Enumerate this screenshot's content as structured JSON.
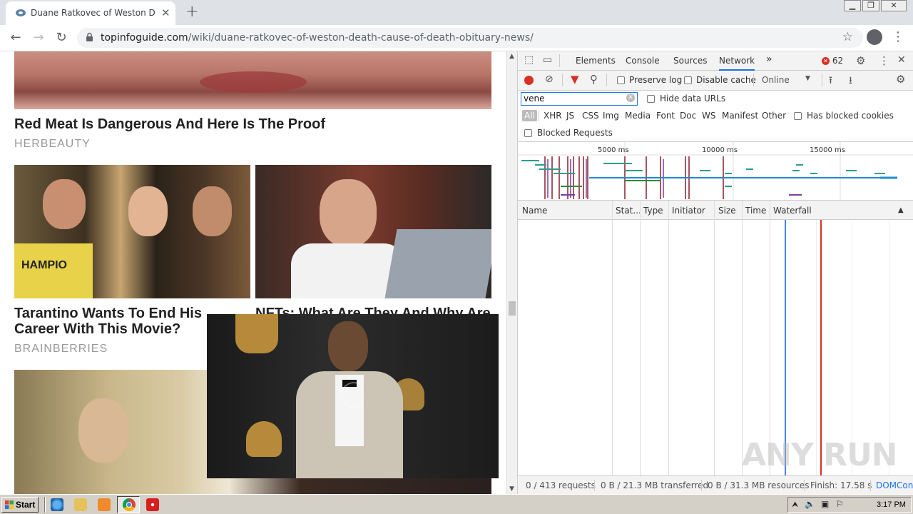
{
  "browser": {
    "tab_title": "Duane Ratkovec of Weston Death –",
    "new_tab_symbol": "+",
    "url_host": "topinfoguide.com",
    "url_path": "/wiki/duane-ratkovec-of-weston-death-cause-of-death-obituary-news/"
  },
  "page": {
    "articles": [
      {
        "title": "Red Meat Is Dangerous And Here Is The Proof",
        "source": "HERBEAUTY"
      },
      {
        "title": "Tarantino Wants To End His Career With This Movie?",
        "source": "BRAINBERRIES"
      },
      {
        "title": "NFTs: What Are They And Why Are",
        "source": ""
      }
    ],
    "photo_text": "HAMPIO"
  },
  "devtools": {
    "tabs": [
      "Elements",
      "Console",
      "Sources",
      "Network"
    ],
    "more_tabs": "»",
    "error_count": "62",
    "toolbar": {
      "preserve_log": "Preserve log",
      "disable_cache": "Disable cache",
      "throttle": "Online"
    },
    "filter": {
      "value": "vene",
      "hide_data_urls": "Hide data URLs"
    },
    "types": [
      "All",
      "XHR",
      "JS",
      "CSS",
      "Img",
      "Media",
      "Font",
      "Doc",
      "WS",
      "Manifest",
      "Other"
    ],
    "has_blocked_cookies": "Has blocked cookies",
    "blocked_requests": "Blocked Requests",
    "timeline_ticks": [
      "5000 ms",
      "10000 ms",
      "15000 ms"
    ],
    "columns": [
      "Name",
      "Stat...",
      "Type",
      "Initiator",
      "Size",
      "Time",
      "Waterfall"
    ],
    "status": {
      "requests": "0 / 413 requests",
      "transferred": "0 B / 21.3 MB transferred",
      "resources": "0 B / 31.3 MB resources",
      "finish": "Finish: 17.58 s",
      "domcon": "DOMCon"
    },
    "colors": {
      "accent": "#1a73e8",
      "error": "#d93025"
    }
  },
  "watermark": "ANY RUN",
  "taskbar": {
    "start_label": "Start",
    "clock": "3:17 PM"
  }
}
